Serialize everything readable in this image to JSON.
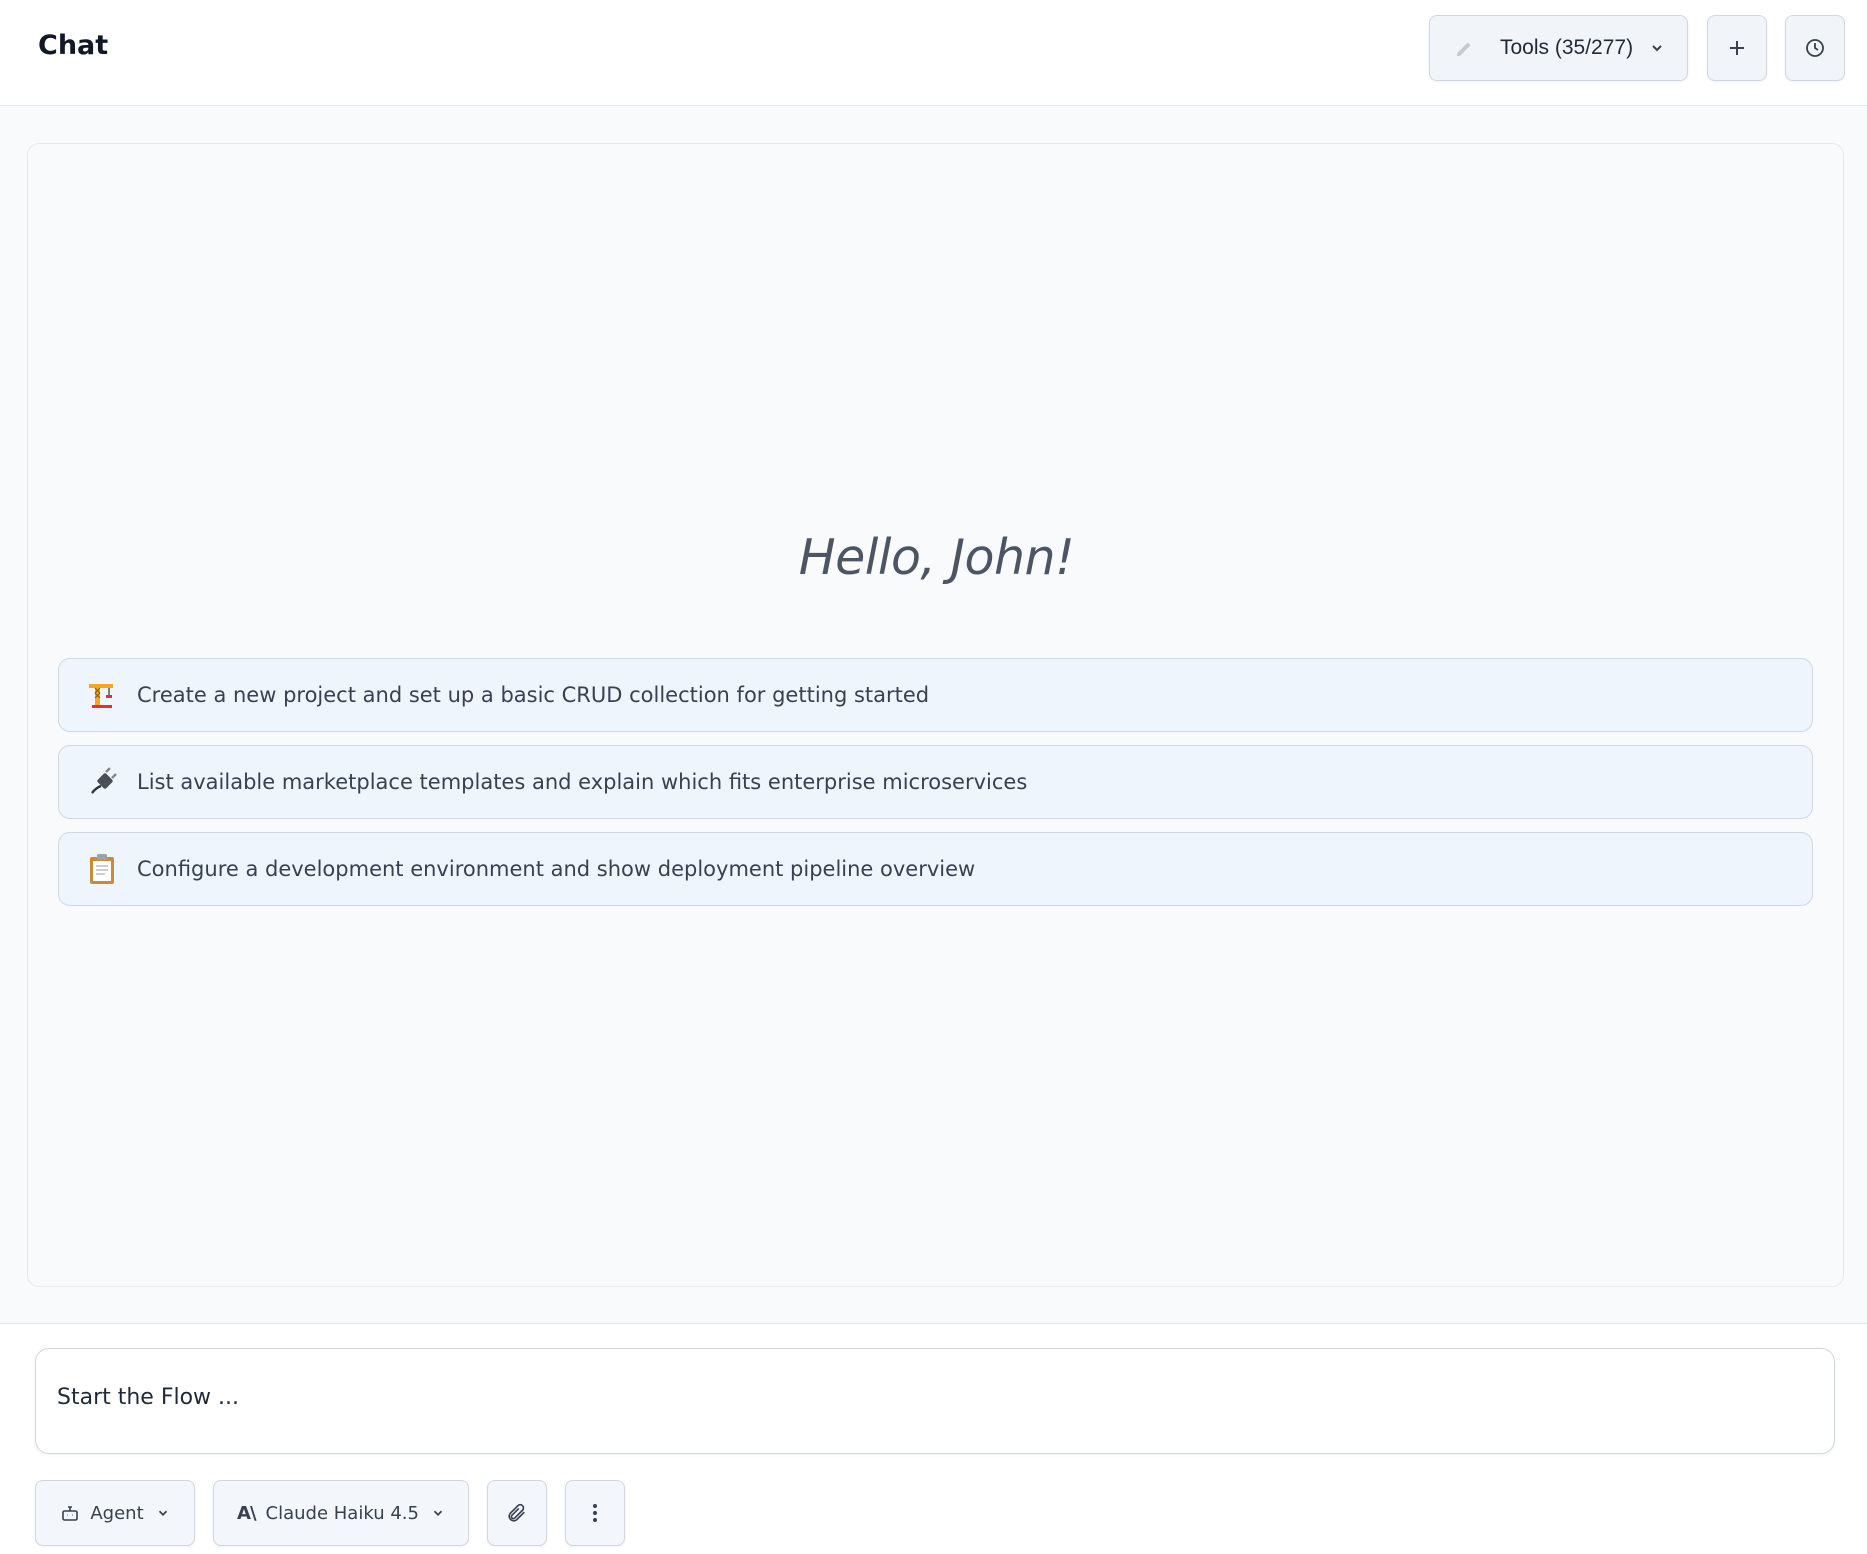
{
  "header": {
    "title": "Chat",
    "tools_label": "Tools (35/277)",
    "new_chat_icon": "plus-icon",
    "history_icon": "clock-icon"
  },
  "main": {
    "greeting": "Hello, John!",
    "suggestions": [
      {
        "emoji": "crane-icon",
        "text": "Create a new project and set up a basic CRUD collection for getting started"
      },
      {
        "emoji": "plug-icon",
        "text": "List available marketplace templates and explain which fits enterprise microservices"
      },
      {
        "emoji": "clipboard-icon",
        "text": "Configure a development environment and show deployment pipeline overview"
      }
    ]
  },
  "input": {
    "placeholder": "Start the Flow ..."
  },
  "toolbar": {
    "mode_label": "Agent",
    "model_label": "Claude Haiku 4.5",
    "model_brand": "A\\"
  },
  "colors": {
    "suggestion_bg": "#eef5fd",
    "suggestion_border": "#ccd8e6",
    "button_bg": "#f1f5fa"
  }
}
